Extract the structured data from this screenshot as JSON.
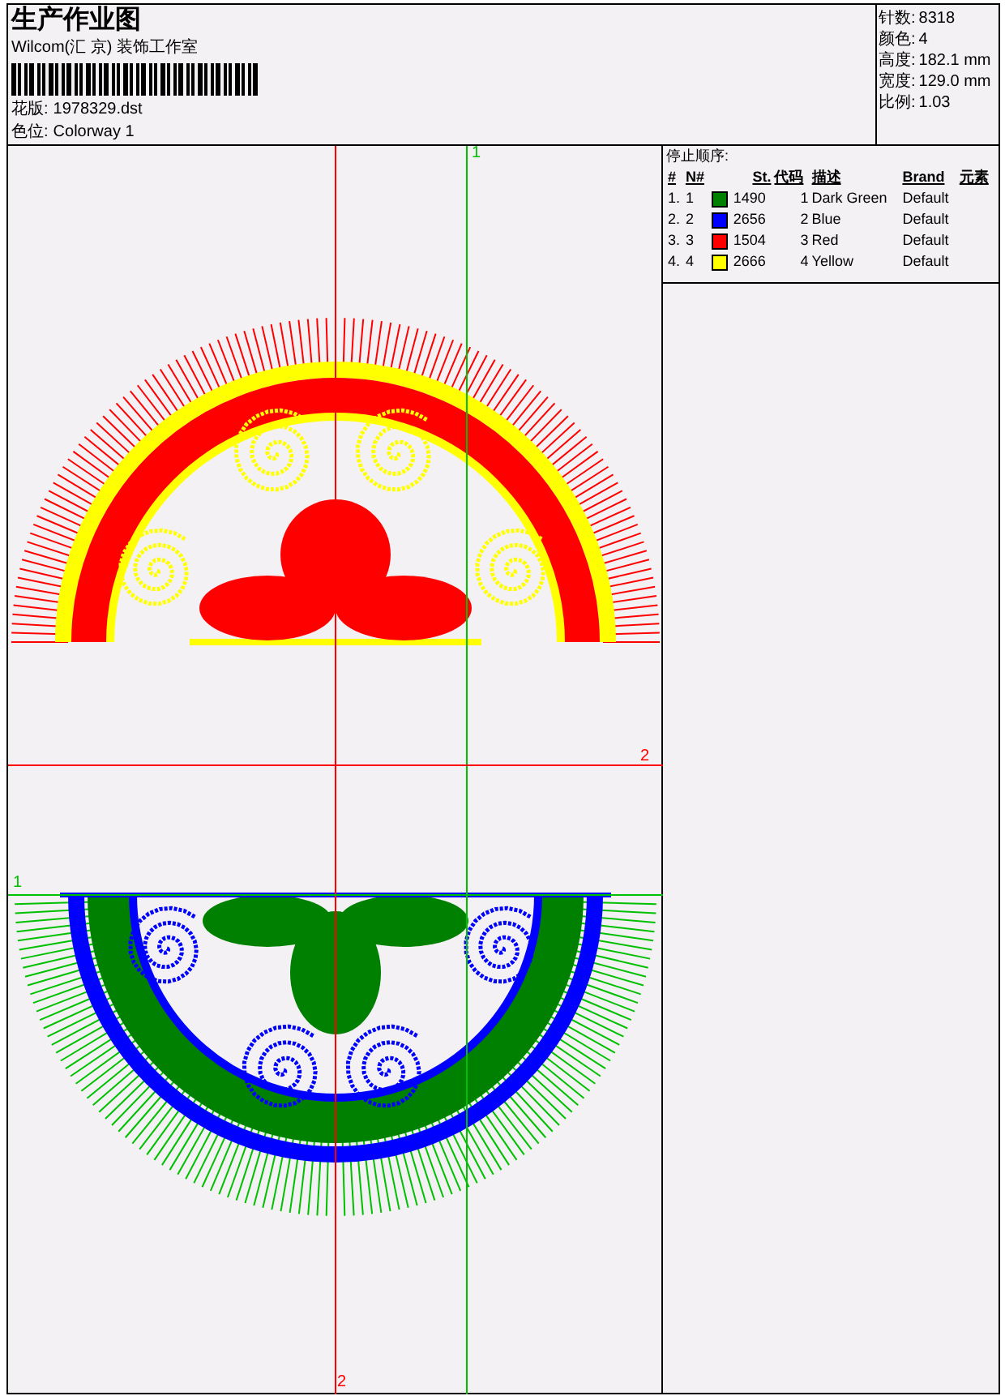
{
  "header": {
    "title": "生产作业图",
    "company": "Wilcom(汇 京) 装饰工作室",
    "fields": [
      {
        "label": "花版:",
        "value": "1978329.dst"
      },
      {
        "label": "色位:",
        "value": "Colorway 1"
      }
    ]
  },
  "stats": [
    {
      "label": "针数:",
      "value": "8318"
    },
    {
      "label": "颜色:",
      "value": "4"
    },
    {
      "label": "高度:",
      "value": "182.1 mm"
    },
    {
      "label": "宽度:",
      "value": "129.0 mm"
    },
    {
      "label": "比例:",
      "value": "1.03"
    }
  ],
  "canvas": {
    "markers": [
      {
        "kind": "top",
        "label": "1"
      },
      {
        "kind": "right",
        "label": "2"
      },
      {
        "kind": "bottom",
        "label": "2"
      },
      {
        "kind": "left",
        "label": "1"
      }
    ]
  },
  "stop_sequence": {
    "title": "停止顺序:",
    "columns": [
      "#",
      "N#",
      "St.",
      "代码",
      "描述",
      "Brand",
      "元素"
    ],
    "rows": [
      {
        "index": "1.",
        "number": "1",
        "color": "#008000",
        "stitches": "1490",
        "code": "1",
        "description": "Dark Green",
        "brand": "Default"
      },
      {
        "index": "2.",
        "number": "2",
        "color": "#0000ff",
        "stitches": "2656",
        "code": "2",
        "description": "Blue",
        "brand": "Default"
      },
      {
        "index": "3.",
        "number": "3",
        "color": "#ff0000",
        "stitches": "1504",
        "code": "3",
        "description": "Red",
        "brand": "Default"
      },
      {
        "index": "4.",
        "number": "4",
        "color": "#ffff00",
        "stitches": "2666",
        "code": "4",
        "description": "Yellow",
        "brand": "Default"
      }
    ]
  }
}
